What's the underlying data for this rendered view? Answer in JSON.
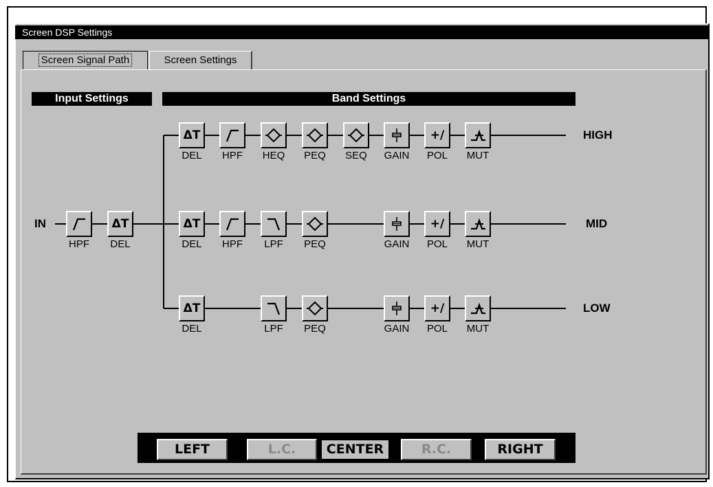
{
  "window": {
    "title": "Screen DSP Settings"
  },
  "tabs": [
    {
      "label": "Screen Signal Path",
      "active": true
    },
    {
      "label": "Screen Settings",
      "active": false
    }
  ],
  "headers": {
    "input": "Input Settings",
    "band": "Band Settings"
  },
  "input": {
    "label": "IN",
    "modules": [
      {
        "label": "HPF",
        "icon": "highpass-icon"
      },
      {
        "label": "DEL",
        "icon": "delta-t-icon"
      }
    ]
  },
  "bands": [
    {
      "name": "HIGH",
      "modules": [
        {
          "label": "DEL",
          "icon": "delta-t-icon"
        },
        {
          "label": "HPF",
          "icon": "highpass-icon"
        },
        {
          "label": "HEQ",
          "icon": "eq-icon"
        },
        {
          "label": "PEQ",
          "icon": "eq-icon"
        },
        {
          "label": "SEQ",
          "icon": "eq-icon"
        },
        {
          "label": "GAIN",
          "icon": "fader-icon"
        },
        {
          "label": "POL",
          "icon": "polarity-icon"
        },
        {
          "label": "MUT",
          "icon": "mute-icon"
        }
      ]
    },
    {
      "name": "MID",
      "modules": [
        {
          "label": "DEL",
          "icon": "delta-t-icon"
        },
        {
          "label": "HPF",
          "icon": "highpass-icon"
        },
        {
          "label": "LPF",
          "icon": "lowpass-icon"
        },
        {
          "label": "PEQ",
          "icon": "eq-icon"
        },
        null,
        {
          "label": "GAIN",
          "icon": "fader-icon"
        },
        {
          "label": "POL",
          "icon": "polarity-icon"
        },
        {
          "label": "MUT",
          "icon": "mute-icon"
        }
      ]
    },
    {
      "name": "LOW",
      "modules": [
        {
          "label": "DEL",
          "icon": "delta-t-icon"
        },
        null,
        {
          "label": "LPF",
          "icon": "lowpass-icon"
        },
        {
          "label": "PEQ",
          "icon": "eq-icon"
        },
        null,
        {
          "label": "GAIN",
          "icon": "fader-icon"
        },
        {
          "label": "POL",
          "icon": "polarity-icon"
        },
        {
          "label": "MUT",
          "icon": "mute-icon"
        }
      ]
    }
  ],
  "channels": [
    {
      "label": "LEFT",
      "state": "enabled"
    },
    {
      "label": "L.C.",
      "state": "disabled"
    },
    {
      "label": "CENTER",
      "state": "selected"
    },
    {
      "label": "R.C.",
      "state": "disabled"
    },
    {
      "label": "RIGHT",
      "state": "enabled"
    }
  ]
}
